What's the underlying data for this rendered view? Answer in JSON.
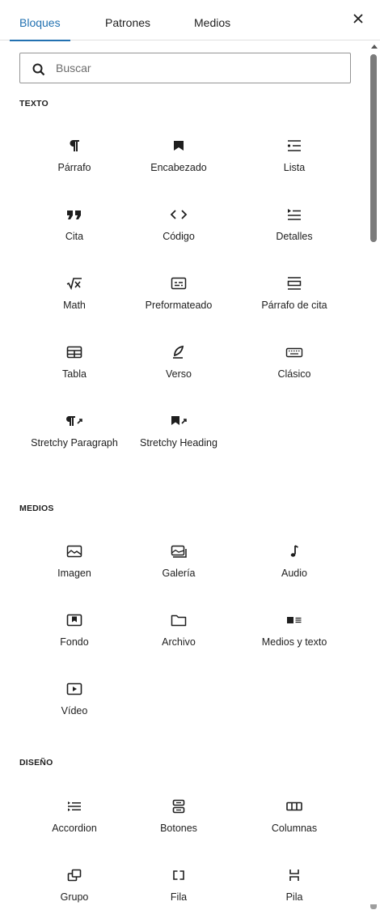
{
  "tabs": {
    "blocks": "Bloques",
    "patterns": "Patrones",
    "media": "Medios"
  },
  "search": {
    "placeholder": "Buscar",
    "value": ""
  },
  "colors": {
    "accent": "#2271b1",
    "text": "#1e1e1e"
  },
  "sections": {
    "text": {
      "heading": "TEXTO",
      "blocks": [
        {
          "label": "Párrafo",
          "icon": "paragraph-icon"
        },
        {
          "label": "Encabezado",
          "icon": "heading-bookmark-icon"
        },
        {
          "label": "Lista",
          "icon": "list-icon"
        },
        {
          "label": "Cita",
          "icon": "quote-icon"
        },
        {
          "label": "Código",
          "icon": "code-icon"
        },
        {
          "label": "Detalles",
          "icon": "details-icon"
        },
        {
          "label": "Math",
          "icon": "math-icon"
        },
        {
          "label": "Preformateado",
          "icon": "preformatted-icon"
        },
        {
          "label": "Párrafo de cita",
          "icon": "pullquote-icon"
        },
        {
          "label": "Tabla",
          "icon": "table-icon"
        },
        {
          "label": "Verso",
          "icon": "verse-feather-icon"
        },
        {
          "label": "Clásico",
          "icon": "keyboard-icon"
        },
        {
          "label": "Stretchy Paragraph",
          "icon": "stretchy-paragraph-icon"
        },
        {
          "label": "Stretchy Heading",
          "icon": "stretchy-heading-icon"
        }
      ]
    },
    "media": {
      "heading": "MEDIOS",
      "blocks": [
        {
          "label": "Imagen",
          "icon": "image-icon"
        },
        {
          "label": "Galería",
          "icon": "gallery-icon"
        },
        {
          "label": "Audio",
          "icon": "audio-note-icon"
        },
        {
          "label": "Fondo",
          "icon": "cover-icon"
        },
        {
          "label": "Archivo",
          "icon": "folder-icon"
        },
        {
          "label": "Medios y texto",
          "icon": "media-text-icon"
        },
        {
          "label": "Vídeo",
          "icon": "video-icon"
        }
      ]
    },
    "design": {
      "heading": "DISEÑO",
      "blocks": [
        {
          "label": "Accordion",
          "icon": "accordion-icon"
        },
        {
          "label": "Botones",
          "icon": "buttons-icon"
        },
        {
          "label": "Columnas",
          "icon": "columns-icon"
        },
        {
          "label": "Grupo",
          "icon": "group-icon"
        },
        {
          "label": "Fila",
          "icon": "row-icon"
        },
        {
          "label": "Pila",
          "icon": "stack-icon"
        }
      ]
    }
  }
}
